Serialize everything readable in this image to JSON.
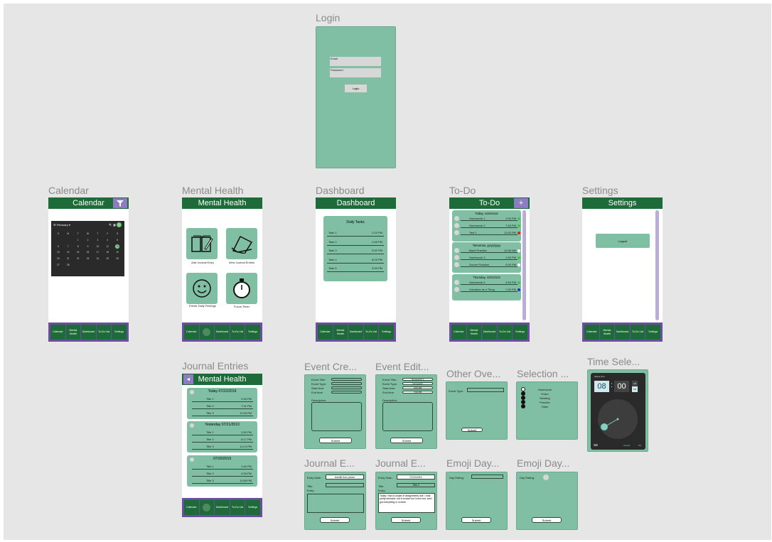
{
  "colors": {
    "canvas": "#e6e6e6",
    "frame_green": "#80bfa3",
    "header_green": "#1e6b3a",
    "nav_purple": "#6b4e9e"
  },
  "nav_labels": [
    "Calendar",
    "Mental Health",
    "Dashboard",
    "To-Do List",
    "Settings"
  ],
  "frame_titles": {
    "login": "Login",
    "calendar": "Calendar",
    "mental_health": "Mental Health",
    "dashboard": "Dashboard",
    "todo": "To-Do",
    "settings": "Settings",
    "journal_entries": "Journal Entries",
    "event_create": "Event Cre...",
    "event_edit": "Event Edit...",
    "other_over": "Other Ove...",
    "selection": "Selection ...",
    "time_select": "Time Sele...",
    "journal_e1": "Journal E...",
    "journal_e2": "Journal E...",
    "emoji_day1": "Emoji Day...",
    "emoji_day2": "Emoji Day..."
  },
  "login": {
    "email_label": "Email",
    "password_label": "Password",
    "login_button": "Login"
  },
  "calendar": {
    "header": "Calendar",
    "month": "February",
    "weekdays": [
      "S",
      "M",
      "T",
      "W",
      "T",
      "F",
      "S"
    ],
    "days": [
      "",
      "",
      "1",
      "2",
      "3",
      "4",
      "5",
      "6",
      "7",
      "8",
      "9",
      "10",
      "11",
      "12",
      "13",
      "14",
      "15",
      "16",
      "17",
      "18",
      "19",
      "20",
      "21",
      "22",
      "23",
      "24",
      "25",
      "26",
      "27",
      "28",
      "",
      "",
      "",
      "",
      "",
      ""
    ],
    "selected_day": "12"
  },
  "mental": {
    "header": "Mental Health",
    "add_journal": "Add Journal Entry",
    "view_journal": "View Journal Entries",
    "emoji_feelings": "Emote Daily Feelings",
    "focus_timer": "Focus Timer"
  },
  "dashboard": {
    "header": "Dashboard",
    "card_title": "Daily Tasks",
    "tasks": [
      {
        "name": "Task 1",
        "time": "2:23 PM"
      },
      {
        "name": "Task 2",
        "time": "2:45 PM"
      },
      {
        "name": "Task 3",
        "time": "5:32 PM"
      },
      {
        "name": "Task 4",
        "time": "8:15 PM"
      },
      {
        "name": "Task 5",
        "time": "9:45 PM"
      }
    ]
  },
  "todo": {
    "header": "To-Do",
    "add": "+",
    "groups": [
      {
        "title": "Today, xx/xx/xxxx",
        "items": [
          {
            "name": "Homework 1",
            "time": "2:30 PM",
            "color": "#33cc33"
          },
          {
            "name": "Homework 2",
            "time": "7:30 PM",
            "color": "#33cc33"
          },
          {
            "name": "Test 1",
            "time": "11:00 PM",
            "color": "#e02020"
          }
        ]
      },
      {
        "title": "Tomorrow, yy/yy/yyyy",
        "items": [
          {
            "name": "Band Practice",
            "time": "10:45 AM",
            "color": "#ffffff"
          },
          {
            "name": "Homework 3",
            "time": "1:30 PM",
            "color": "#33cc33"
          },
          {
            "name": "Soccer Practice",
            "time": "5:30 PM",
            "color": "#ffffff"
          }
        ]
      },
      {
        "title": "Thursday, zz/zz/zzzz",
        "items": [
          {
            "name": "Homework 4",
            "time": "3:30 PM",
            "color": "#33cc33"
          },
          {
            "name": "Volunteer at a Thing",
            "time": "7:30 PM",
            "color": "#2030e0"
          }
        ]
      }
    ]
  },
  "settings": {
    "header": "Settings",
    "logout": "Logout"
  },
  "journal_entries": {
    "header": "Mental Health",
    "back": "◄",
    "groups": [
      {
        "title": "Today 07/22/2019",
        "items": [
          {
            "name": "Title 1",
            "time": "2:05 PM"
          },
          {
            "name": "Title 2",
            "time": "7:31 PM"
          },
          {
            "name": "Title 3",
            "time": "11:56 PM"
          }
        ]
      },
      {
        "title": "Yesterday 07/21/2019",
        "items": [
          {
            "name": "Title 1",
            "time": "2:53 PM"
          },
          {
            "name": "Title 2",
            "time": "8:17 PM"
          },
          {
            "name": "Title 3",
            "time": "11:24 PM"
          }
        ]
      },
      {
        "title": "07/20/2019",
        "items": [
          {
            "name": "Title 1",
            "time": "1:45 PM"
          },
          {
            "name": "Title 2",
            "time": "4:28 PM"
          },
          {
            "name": "Title 3",
            "time": "11:58 PM"
          }
        ]
      }
    ]
  },
  "event_form": {
    "fields": [
      "Event Title:",
      "Event Type:",
      "Start time:",
      "End time:"
    ],
    "description": "Description:",
    "submit": "Submit"
  },
  "event_edit": {
    "values": [
      "Homework 1",
      "Homework",
      "3:00 PM",
      "7:00 PM"
    ]
  },
  "other_over": {
    "label": "Event Type:",
    "submit": "Submit"
  },
  "selection": {
    "options": [
      "Homework",
      "Exam",
      "Meeting",
      "Practice",
      "Other"
    ]
  },
  "time_select": {
    "title": "Select time",
    "hour": "08",
    "minute": "00",
    "am": "AM",
    "pm": "PM",
    "cancel": "Cancel",
    "ok": "OK"
  },
  "journal_form1": {
    "entry_date": "Entry Date:",
    "date_value": "Autofill from phone",
    "title": "Title:",
    "entry": "Entry:",
    "submit": "Submit"
  },
  "journal_form2": {
    "entry_date": "Entry Date:",
    "date_value": "07/22/2019",
    "title": "Title:",
    "title_value": "Title 3",
    "entry": "Entry:",
    "entry_text": "Today I had a couple of assignments due. I was pretty stressed, but it worked out in the end, and I got everything in on time.",
    "submit": "Submit"
  },
  "emoji_form": {
    "day_rating": "Day Rating:",
    "submit": "Submit"
  }
}
